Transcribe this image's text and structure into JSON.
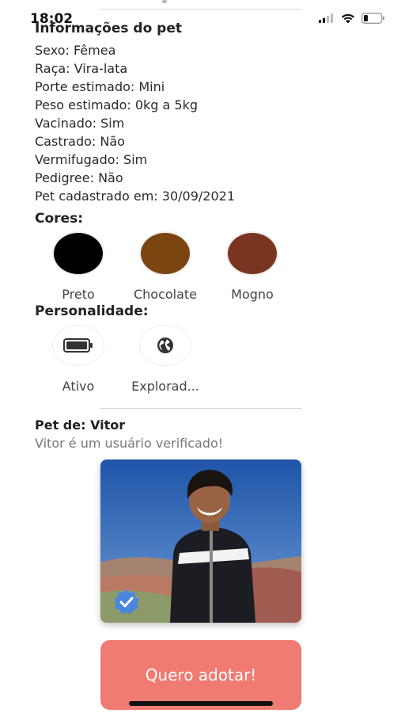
{
  "status_bar": {
    "time": "18:02"
  },
  "pet_info": {
    "title": "Informações do pet",
    "lines": [
      "Sexo: Fêmea",
      "Raça: Vira-lata",
      "Porte estimado: Mini",
      "Peso estimado: 0kg a 5kg",
      "Vacinado: Sim",
      "Castrado: Não",
      "Vermifugado: Sim",
      "Pedigree: Não",
      "Pet cadastrado em: 30/09/2021"
    ]
  },
  "colors": {
    "title": "Cores:",
    "items": [
      {
        "name": "Preto",
        "hex": "#000000"
      },
      {
        "name": "Chocolate",
        "hex": "#7b4511"
      },
      {
        "name": "Mogno",
        "hex": "#7a3520"
      }
    ]
  },
  "personality": {
    "title": "Personalidade:",
    "items": [
      {
        "name": "Ativo",
        "icon": "battery-icon"
      },
      {
        "name": "Explorad...",
        "icon": "globe-icon"
      }
    ]
  },
  "owner": {
    "title": "Pet de: Vitor",
    "subtitle": "Vitor é um usuário verificado!",
    "photo_icon": "verified-badge-icon",
    "badge_color": "#4a86e0"
  },
  "adopt": {
    "label": "Quero adotar!",
    "color": "#ef7b72"
  }
}
